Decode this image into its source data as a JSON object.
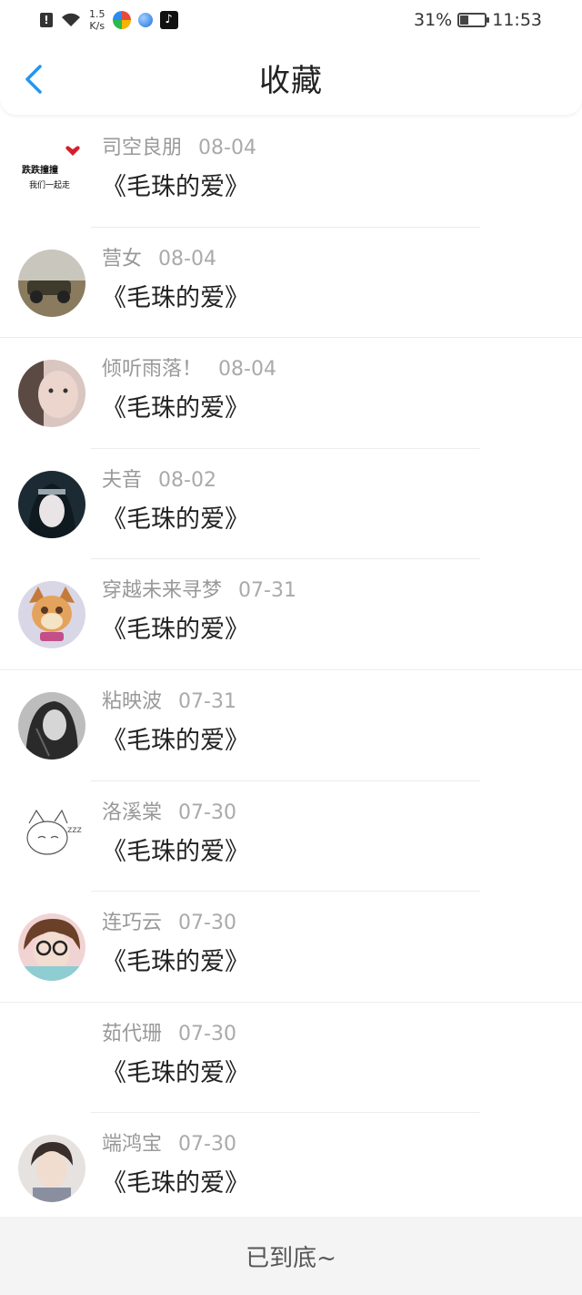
{
  "status_bar": {
    "netspeed_value": "1.5",
    "netspeed_unit": "K/s",
    "battery": "31%",
    "battery_level": 0.31,
    "time": "11:53"
  },
  "header": {
    "title": "收藏",
    "back_icon": "chevron-left-icon",
    "accent_color": "#2196f3"
  },
  "items": [
    {
      "name": "司空良朋",
      "date": "08-04",
      "title": "《毛珠的爱》",
      "avatar_caption_1": "跌跌撞撞",
      "avatar_caption_2": "我们一起走"
    },
    {
      "name": "营女",
      "date": "08-04",
      "title": "《毛珠的爱》"
    },
    {
      "name": "倾听雨落！",
      "date": "08-04",
      "title": "《毛珠的爱》"
    },
    {
      "name": "夫音",
      "date": "08-02",
      "title": "《毛珠的爱》"
    },
    {
      "name": "穿越未来寻梦",
      "date": "07-31",
      "title": "《毛珠的爱》"
    },
    {
      "name": "粘映波",
      "date": "07-31",
      "title": "《毛珠的爱》"
    },
    {
      "name": "洛溪棠",
      "date": "07-30",
      "title": "《毛珠的爱》"
    },
    {
      "name": "连巧云",
      "date": "07-30",
      "title": "《毛珠的爱》"
    },
    {
      "name": "茹代珊",
      "date": "07-30",
      "title": "《毛珠的爱》"
    },
    {
      "name": "端鸿宝",
      "date": "07-30",
      "title": "《毛珠的爱》"
    }
  ],
  "footer": {
    "text": "已到底~"
  }
}
